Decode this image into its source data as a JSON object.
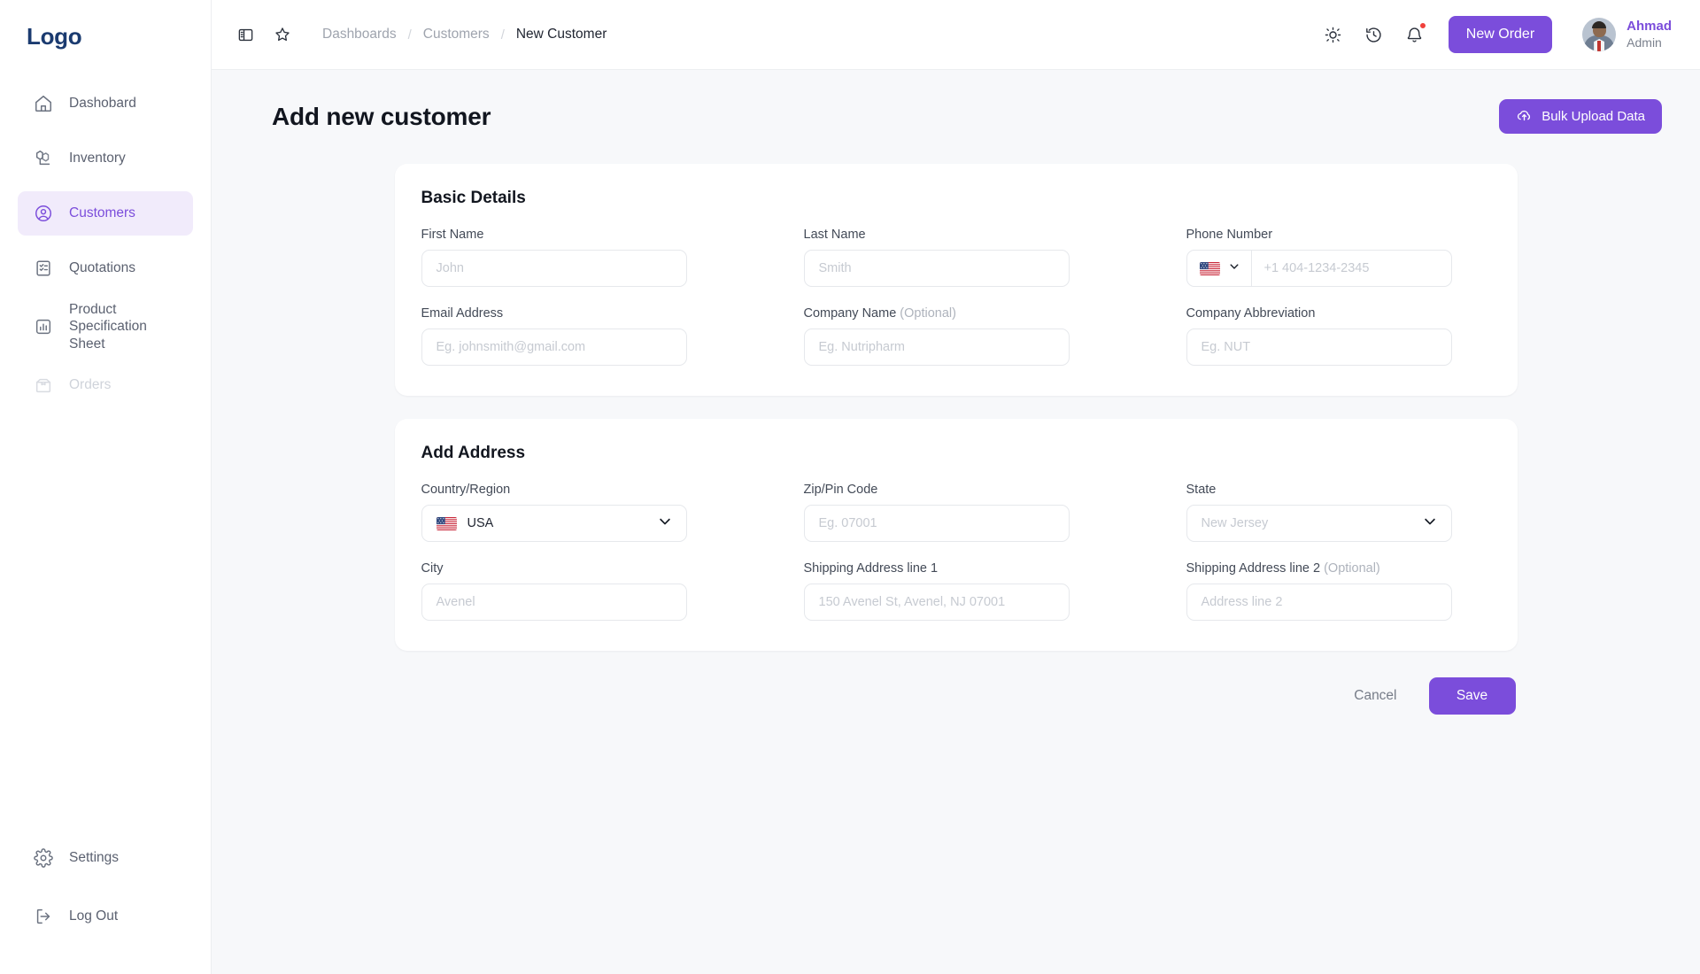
{
  "brand": {
    "logo": "Logo",
    "accent": "#7b4ddb",
    "logo_color": "#1b3b70"
  },
  "sidebar": {
    "items": [
      {
        "label": "Dashobard",
        "icon": "home-icon",
        "state": "normal"
      },
      {
        "label": "Inventory",
        "icon": "inventory-icon",
        "state": "normal"
      },
      {
        "label": "Customers",
        "icon": "user-circle-icon",
        "state": "active"
      },
      {
        "label": "Quotations",
        "icon": "clipboard-list-icon",
        "state": "normal"
      },
      {
        "label": "Product Specification Sheet",
        "icon": "bar-chart-icon",
        "state": "normal"
      },
      {
        "label": "Orders",
        "icon": "box-icon",
        "state": "disabled"
      }
    ],
    "bottom_items": [
      {
        "label": "Settings",
        "icon": "gear-icon"
      },
      {
        "label": "Log Out",
        "icon": "logout-icon"
      }
    ]
  },
  "topbar": {
    "panel_toggle_icon": "panel-toggle-icon",
    "star_icon": "star-icon",
    "breadcrumb": [
      {
        "label": "Dashboards",
        "current": false
      },
      {
        "label": "Customers",
        "current": false
      },
      {
        "label": "New Customer",
        "current": true
      }
    ],
    "separator": "/",
    "theme_icon": "sun-icon",
    "history_icon": "history-icon",
    "notification_icon": "bell-icon",
    "has_notification": true,
    "new_order_label": "New Order",
    "user": {
      "name": "Ahmad",
      "role": "Admin",
      "avatar": "user-avatar"
    }
  },
  "page": {
    "title": "Add new customer",
    "bulk_upload_label": "Bulk Upload Data",
    "bulk_upload_icon": "cloud-upload-icon"
  },
  "basic_details": {
    "title": "Basic Details",
    "fields": {
      "first_name": {
        "label": "First Name",
        "value": "",
        "placeholder": "John"
      },
      "last_name": {
        "label": "Last Name",
        "value": "",
        "placeholder": "Smith"
      },
      "phone": {
        "label": "Phone Number",
        "value": "",
        "placeholder": "+1 404-1234-2345",
        "country_flag": "us-flag-icon"
      },
      "email": {
        "label": "Email Address",
        "value": "",
        "placeholder": "Eg. johnsmith@gmail.com"
      },
      "company_name": {
        "label": "Company Name",
        "optional": "(Optional)",
        "value": "",
        "placeholder": "Eg. Nutripharm"
      },
      "company_abbr": {
        "label": "Company Abbreviation",
        "value": "",
        "placeholder": "Eg. NUT"
      }
    }
  },
  "add_address": {
    "title": "Add Address",
    "fields": {
      "country": {
        "label": "Country/Region",
        "value": "USA",
        "flag": "us-flag-icon"
      },
      "zip": {
        "label": "Zip/Pin Code",
        "value": "",
        "placeholder": "Eg. 07001"
      },
      "state": {
        "label": "State",
        "value": "",
        "placeholder": "New Jersey"
      },
      "city": {
        "label": "City",
        "value": "",
        "placeholder": "Avenel"
      },
      "address1": {
        "label": "Shipping Address line 1",
        "value": "",
        "placeholder": "150 Avenel St, Avenel, NJ 07001"
      },
      "address2": {
        "label": "Shipping Address line 2",
        "optional": "(Optional)",
        "value": "",
        "placeholder": "Address line 2"
      }
    }
  },
  "footer_actions": {
    "cancel_label": "Cancel",
    "save_label": "Save"
  }
}
